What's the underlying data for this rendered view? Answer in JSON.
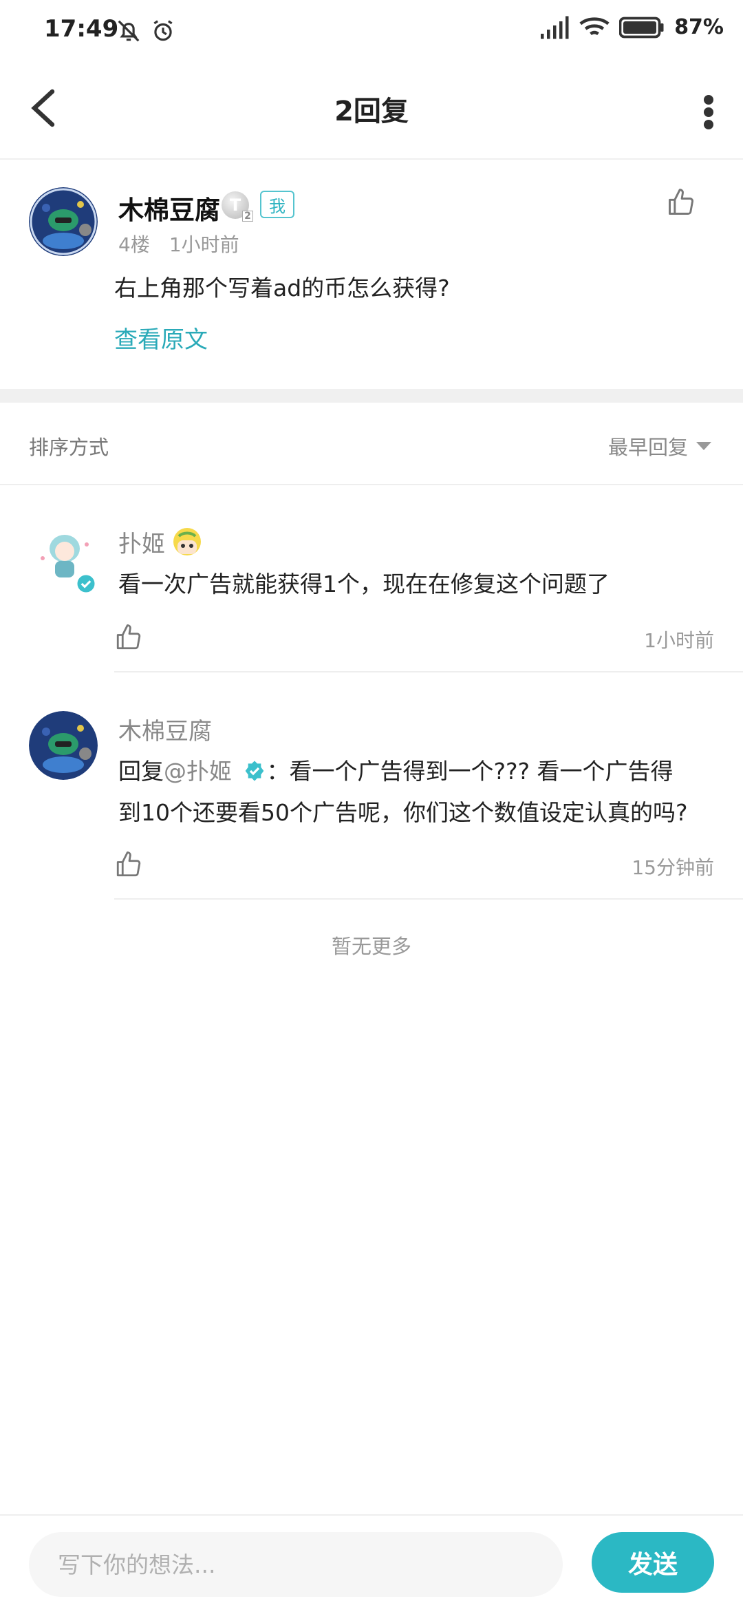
{
  "status_bar": {
    "time": "17:49",
    "battery": "87%"
  },
  "header": {
    "title": "2回复"
  },
  "main_comment": {
    "author": "木棉豆腐",
    "level_badge": "T",
    "level_sub": "2",
    "me_tag": "我",
    "floor": "4楼",
    "time": "1小时前",
    "content": "右上角那个写着ad的币怎么获得?",
    "view_original": "查看原文"
  },
  "sort": {
    "label": "排序方式",
    "value": "最早回复"
  },
  "replies": [
    {
      "author": "扑姬",
      "content": "看一次广告就能获得1个，现在在修复这个问题了",
      "time": "1小时前"
    },
    {
      "author": "木棉豆腐",
      "reply_prefix": "回复",
      "reply_to": "@扑姬",
      "content_line1": "：看一个广告得到一个??? 看一个广告得",
      "content_line2": "到10个还要看50个广告呢，你们这个数值设定认真的吗?",
      "time": "15分钟前"
    }
  ],
  "no_more": "暂无更多",
  "composer": {
    "placeholder": "写下你的想法...",
    "send_label": "发送"
  },
  "colors": {
    "accent": "#2bb8c4",
    "link": "#2aaab8"
  }
}
